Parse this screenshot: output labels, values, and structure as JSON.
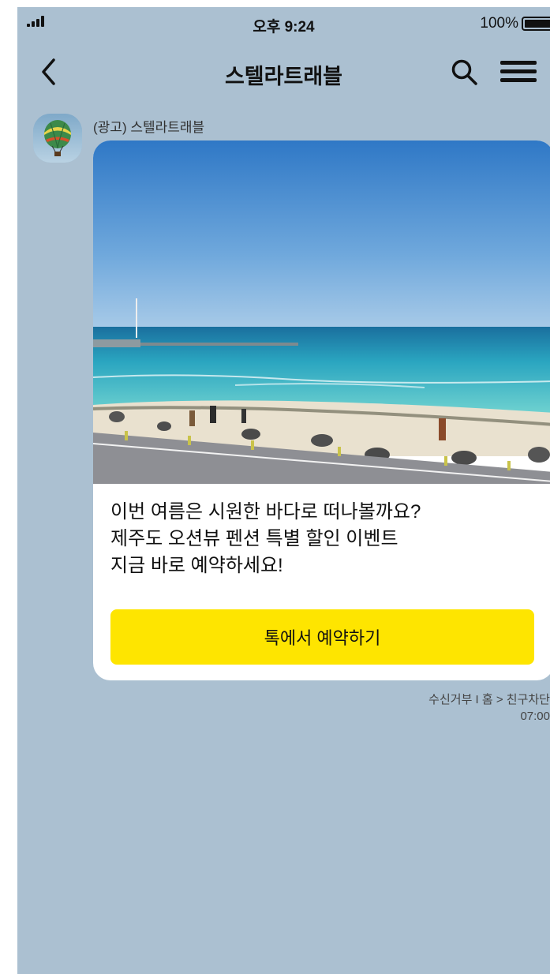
{
  "status_bar": {
    "time": "오후 9:24",
    "battery": "100%"
  },
  "header": {
    "title": "스텔라트래블",
    "back_icon": "chevron-left-icon",
    "search_icon": "search-icon",
    "menu_icon": "hamburger-menu-icon"
  },
  "message": {
    "sender": "(광고) 스텔라트래블",
    "image_alt": "beach-photo",
    "lines": [
      "이번 여름은 시원한 바다로 떠나볼까요?",
      "제주도 오션뷰 펜션 특별 할인 이벤트",
      "지금 바로 예약하세요!"
    ],
    "button_label": "톡에서 예약하기",
    "button_color": "#fee500",
    "footer": {
      "unsubscribe": "수신거부",
      "separator": "I",
      "path": "홈 > 친구차단"
    },
    "time": "07:00"
  },
  "colors": {
    "background": "#abc0d1",
    "bubble": "#ffffff"
  }
}
